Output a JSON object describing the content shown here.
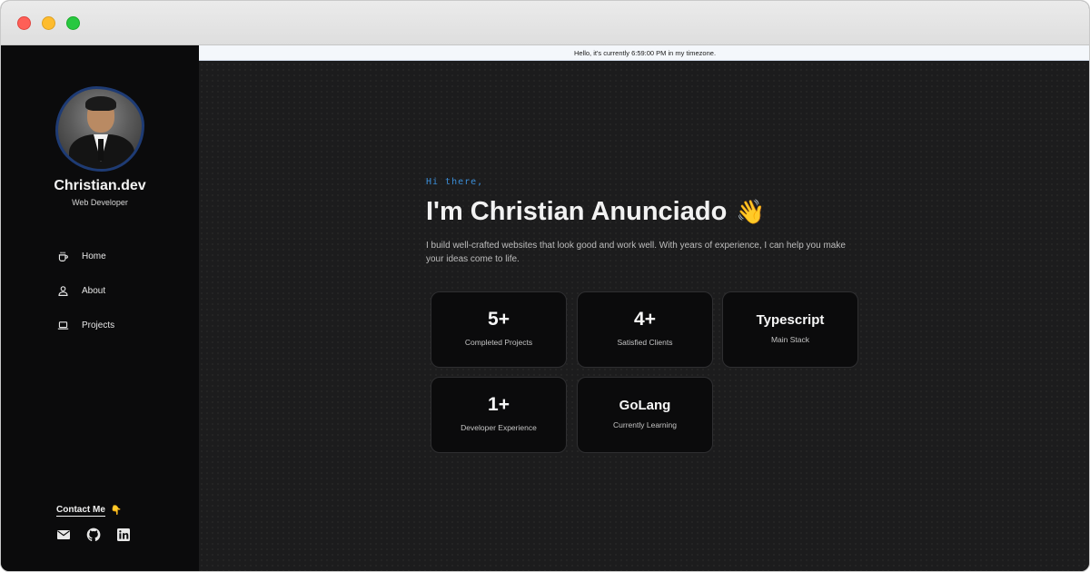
{
  "window": {
    "controls": [
      "close",
      "minimize",
      "zoom"
    ]
  },
  "topbar": {
    "clock_message": "Hello, it's currently 6:59:00 PM in my timezone."
  },
  "sidebar": {
    "brand": "Christian.dev",
    "role": "Web Developer",
    "nav": [
      {
        "label": "Home",
        "icon": "coffee-cup-icon"
      },
      {
        "label": "About",
        "icon": "user-icon"
      },
      {
        "label": "Projects",
        "icon": "laptop-icon"
      }
    ],
    "contact_label": "Contact Me",
    "contact_emoji": "👇",
    "socials": [
      "mail-icon",
      "github-icon",
      "linkedin-icon"
    ]
  },
  "hero": {
    "greeting": "Hi there,",
    "headline": "I'm Christian Anunciado",
    "wave_emoji": "👋",
    "intro": "I build well-crafted websites that look good and work well. With years of experience, I can help you make your ideas come to life."
  },
  "stats": [
    {
      "value": "5+",
      "label": "Completed Projects"
    },
    {
      "value": "4+",
      "label": "Satisfied Clients"
    },
    {
      "value": "Typescript",
      "label": "Main Stack"
    },
    {
      "value": "1+",
      "label": "Developer Experience"
    },
    {
      "value": "GoLang",
      "label": "Currently Learning"
    }
  ],
  "colors": {
    "sidebar_bg": "#0b0b0c",
    "main_bg": "#1c1c1d",
    "accent": "#3b8ed8",
    "card_bg": "#0b0b0c"
  }
}
